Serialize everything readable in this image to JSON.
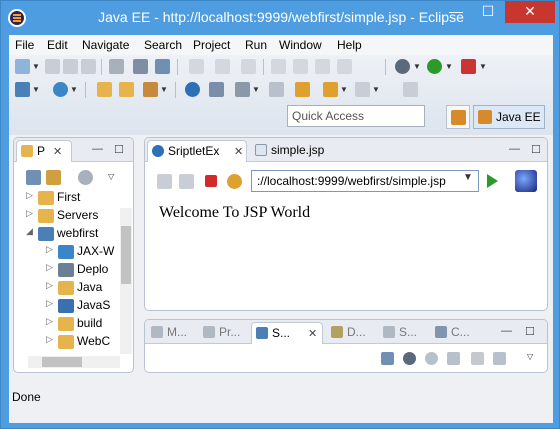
{
  "window": {
    "title": "Java EE - http://localhost:9999/webfirst/simple.jsp - Eclipse",
    "minimize_glyph": "—",
    "maximize_glyph": "☐",
    "close_glyph": "✕"
  },
  "menubar": {
    "items": [
      {
        "label": "File"
      },
      {
        "label": "Edit"
      },
      {
        "label": "Navigate"
      },
      {
        "label": "Search"
      },
      {
        "label": "Project"
      },
      {
        "label": "Run"
      },
      {
        "label": "Window"
      },
      {
        "label": "Help"
      }
    ]
  },
  "toolbar": {
    "quick_access_placeholder": "Quick Access",
    "perspective_label": "Java EE"
  },
  "left_panel": {
    "tab_label": "P",
    "close_glyph": "✕",
    "minimize_glyph": "—",
    "maximize_glyph": "☐",
    "tree": [
      {
        "label": "First"
      },
      {
        "label": "Servers"
      },
      {
        "label": "webfirst"
      },
      {
        "label": "JAX-W"
      },
      {
        "label": "Deplo"
      },
      {
        "label": "Java"
      },
      {
        "label": "JavaS"
      },
      {
        "label": "build"
      },
      {
        "label": "WebC"
      }
    ]
  },
  "editor": {
    "tabs": [
      {
        "label": "SriptletEx"
      },
      {
        "label": "simple.jsp"
      }
    ],
    "close_glyph": "✕",
    "url_value": "://localhost:9999/webfirst/simple.jsp",
    "page_text": "Welcome To JSP World"
  },
  "bottom_panel": {
    "tabs": [
      {
        "label": "M..."
      },
      {
        "label": "Pr..."
      },
      {
        "label": "S..."
      },
      {
        "label": "D..."
      },
      {
        "label": "S..."
      },
      {
        "label": "C..."
      }
    ],
    "close_glyph": "✕"
  },
  "status": {
    "text": "Done"
  },
  "colors": {
    "titlebar": "#4f9de1",
    "close_button": "#c7372f",
    "accent": "#2b9a2b"
  }
}
